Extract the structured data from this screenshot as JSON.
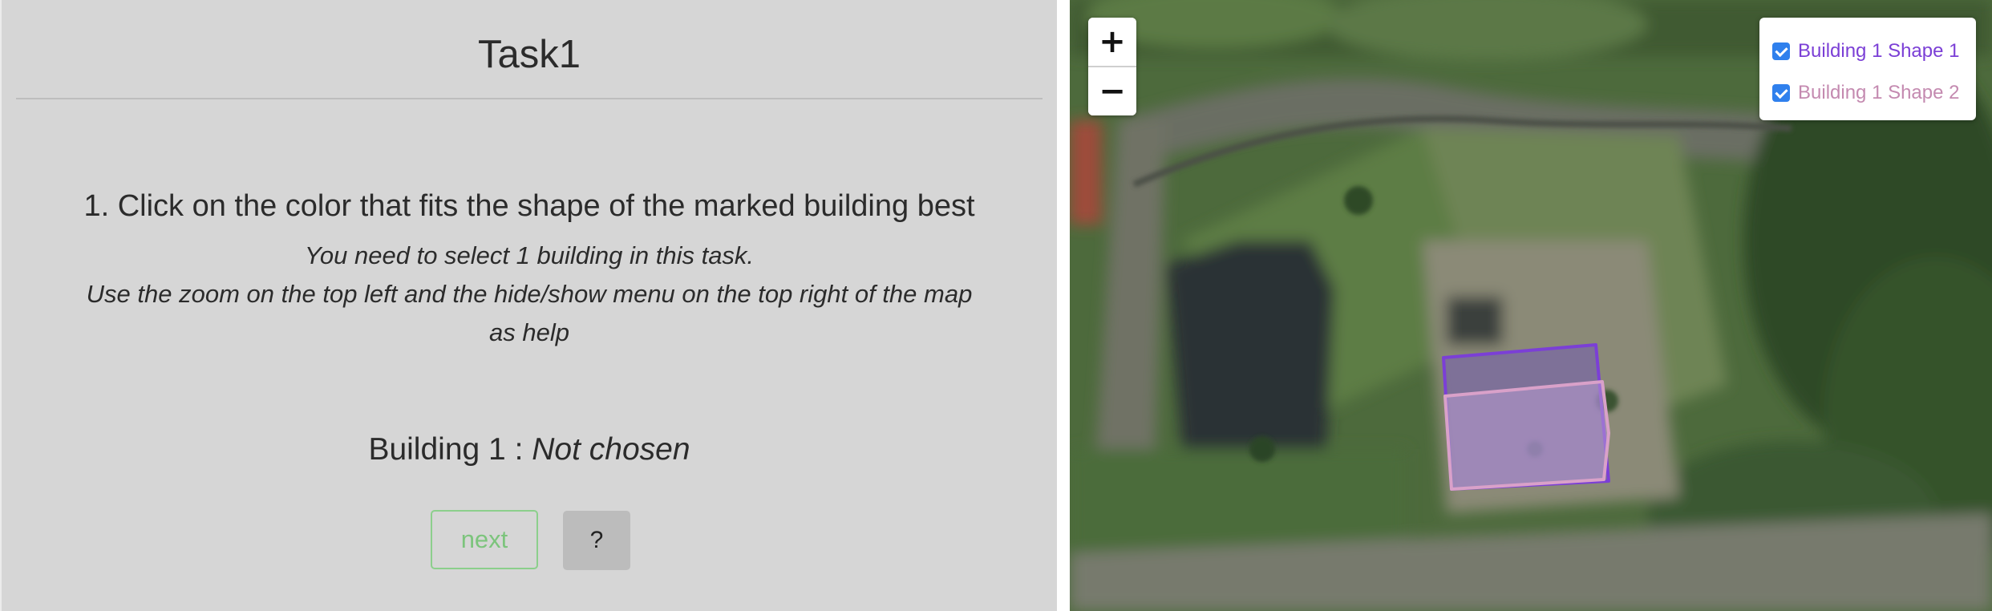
{
  "task": {
    "title": "Task1",
    "question": "1. Click on the color that fits the shape of the marked building best",
    "instructions": [
      "You need to select 1 building in this task.",
      "Use the zoom on the top left and the hide/show menu on the top right of the map",
      "as help"
    ],
    "status_label": "Building 1 :",
    "status_value": "Not chosen"
  },
  "buttons": {
    "next_label": "next",
    "help_label": "?"
  },
  "map": {
    "zoom_in_label": "+",
    "zoom_out_label": "−",
    "layers": [
      {
        "label": "Building 1 Shape 1",
        "checked": true,
        "color": "#7b3fd6"
      },
      {
        "label": "Building 1 Shape 2",
        "checked": true,
        "color": "#c48ab0"
      }
    ]
  },
  "colors": {
    "panel_bg": "#d6d6d6",
    "next_button": "#7cc47c",
    "shape_1": "#7b3fd6",
    "shape_2": "#d9a1c9",
    "checkbox": "#2f80ed"
  },
  "icons": {
    "zoom_in": "plus-icon",
    "zoom_out": "minus-icon",
    "layer_toggle": "checkbox-icon"
  }
}
